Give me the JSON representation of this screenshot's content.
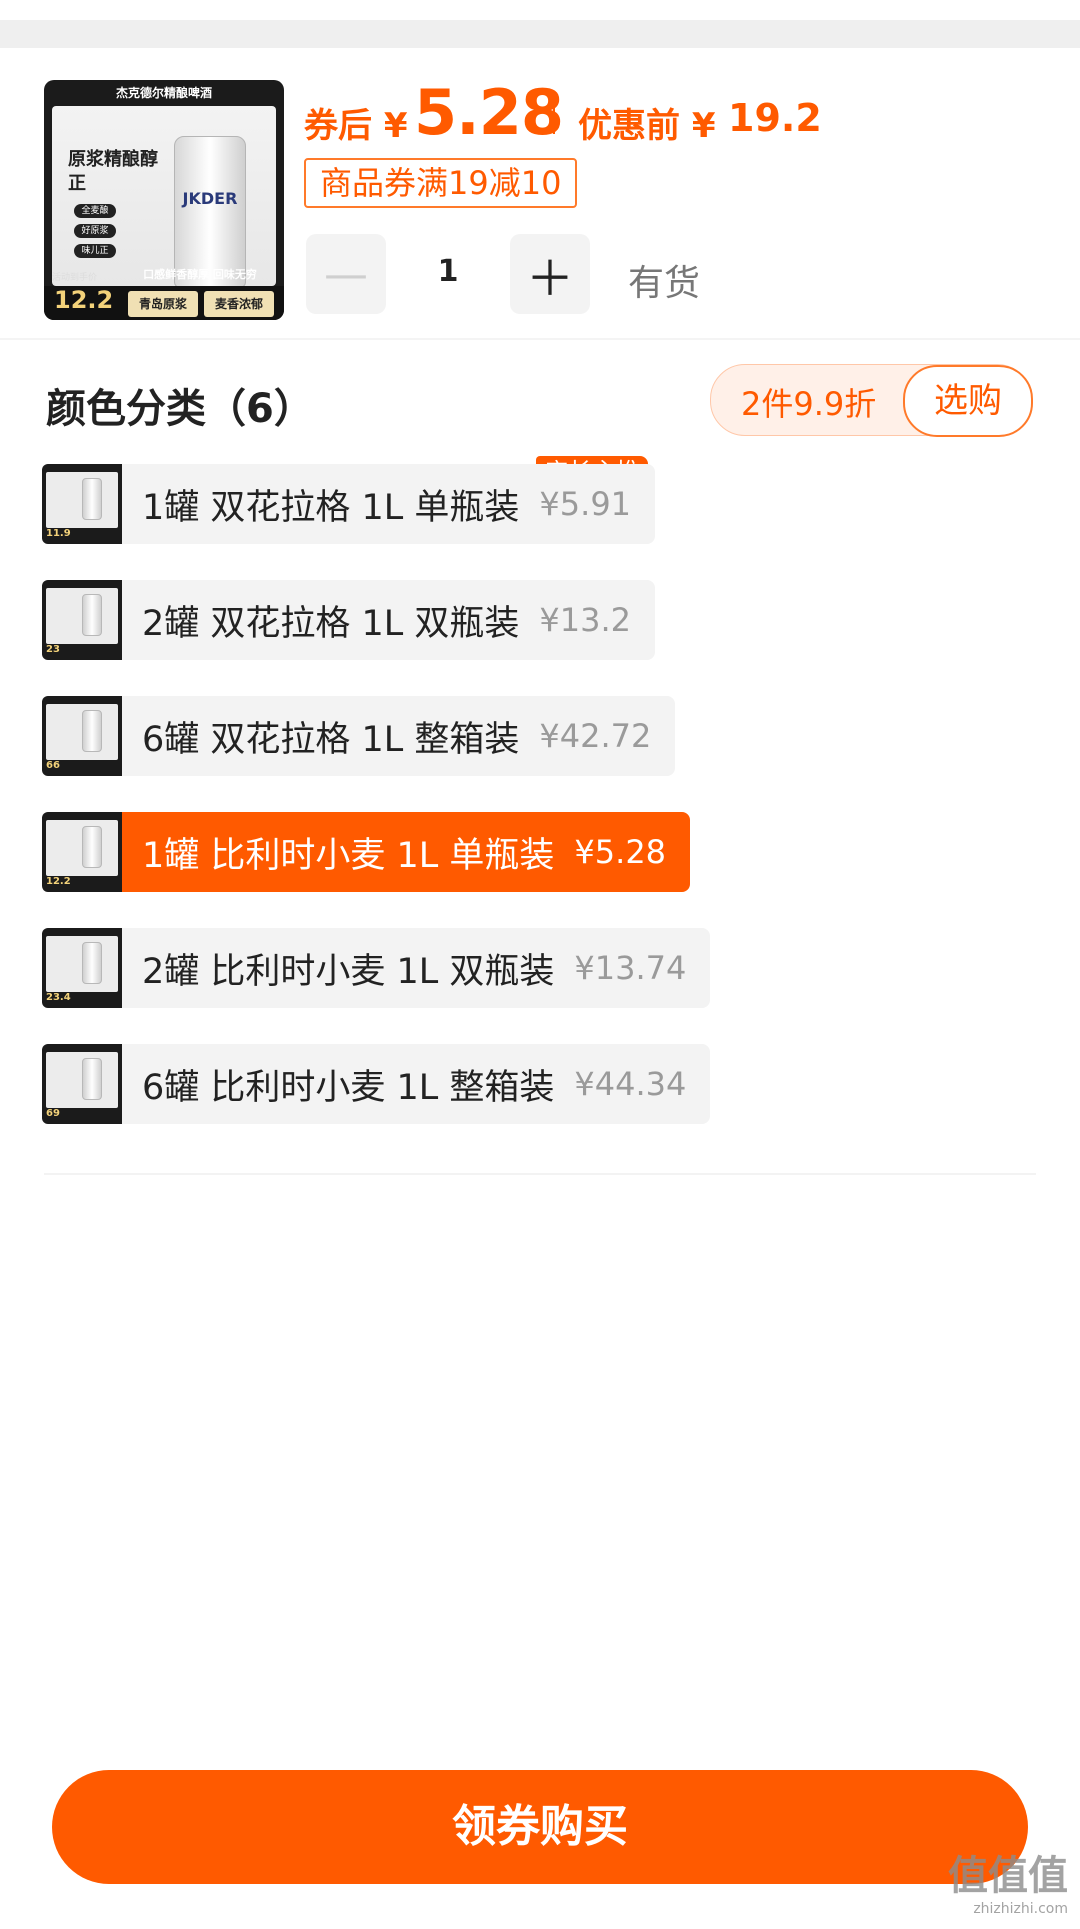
{
  "product": {
    "thumbnail": {
      "brand": "杰克德尔精酿啤酒",
      "left_text": "原浆精酿醇正",
      "chips": [
        "全麦酿",
        "好原浆",
        "味儿正"
      ],
      "can_label": "JKDER",
      "slogan": "口感鲜香醇厚 回味无穷",
      "price_label": "活动到手价",
      "price": "12.2",
      "tag_left": "青岛原浆",
      "tag_right": "麦香浓郁"
    },
    "price_after_label": "券后 ¥",
    "price_after_value": "5.28",
    "price_before_label": "优惠前 ¥",
    "price_before_value": "19.2",
    "coupon": "商品券满19减10",
    "quantity": "1",
    "stock_status": "有货",
    "stepper": {
      "minus_icon": "minus-icon",
      "plus_icon": "plus-icon"
    }
  },
  "section": {
    "title": "颜色分类（6）",
    "promo_text": "2件9.9折",
    "promo_button": "选购"
  },
  "options": [
    {
      "label": "1罐 双花拉格 1L 单瓶装",
      "price": "¥5.91",
      "thumb_price": "11.9",
      "badge": "店长主推",
      "selected": false
    },
    {
      "label": "2罐 双花拉格 1L 双瓶装",
      "price": "¥13.2",
      "thumb_price": "23",
      "badge": "",
      "selected": false
    },
    {
      "label": "6罐 双花拉格 1L 整箱装",
      "price": "¥42.72",
      "thumb_price": "66",
      "badge": "",
      "selected": false
    },
    {
      "label": "1罐 比利时小麦 1L 单瓶装",
      "price": "¥5.28",
      "thumb_price": "12.2",
      "badge": "",
      "selected": true
    },
    {
      "label": "2罐 比利时小麦 1L 双瓶装",
      "price": "¥13.74",
      "thumb_price": "23.4",
      "badge": "",
      "selected": false
    },
    {
      "label": "6罐 比利时小麦 1L 整箱装",
      "price": "¥44.34",
      "thumb_price": "69",
      "badge": "",
      "selected": false
    }
  ],
  "cta": {
    "label": "领券购买"
  },
  "watermark": {
    "main": "值值值",
    "sub": "zhizhizhi.com"
  },
  "colors": {
    "accent": "#ff5a00",
    "muted_bg": "#f3f3f3"
  }
}
